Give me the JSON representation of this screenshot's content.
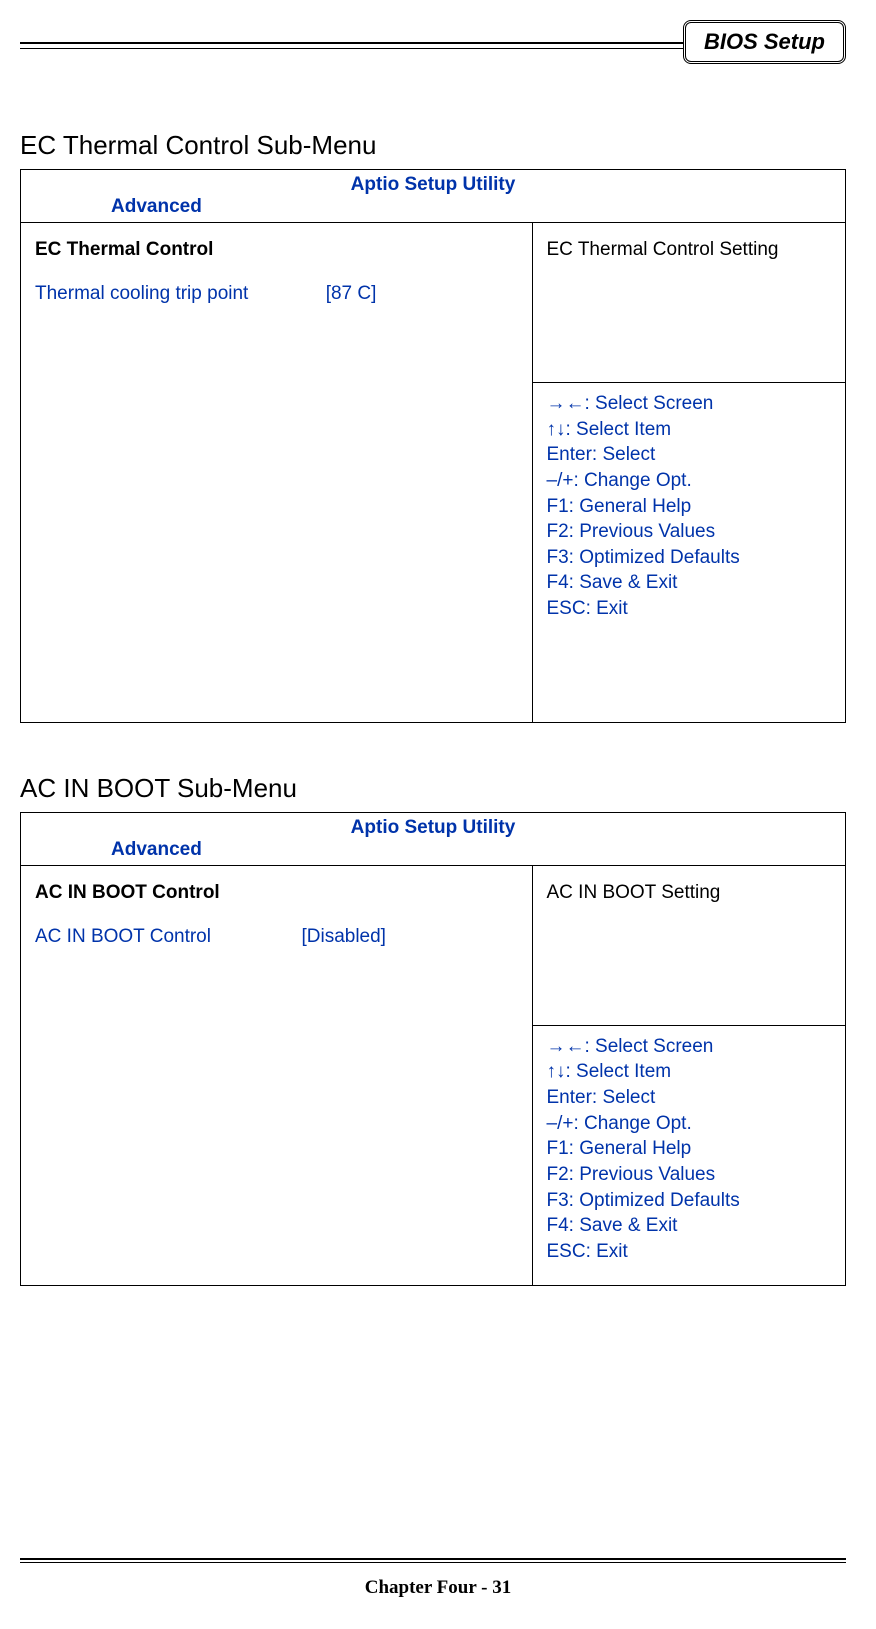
{
  "header_tag": "BIOS Setup",
  "section1": {
    "title": "EC Thermal Control Sub-Menu",
    "utility_title": "Aptio Setup Utility",
    "tab": "Advanced",
    "group_heading": "EC Thermal Control",
    "opt_label": "Thermal cooling trip point",
    "opt_value": "[87 C]",
    "description": "EC Thermal Control Setting"
  },
  "section2": {
    "title": "AC IN BOOT Sub-Menu",
    "utility_title": "Aptio Setup Utility",
    "tab": "Advanced",
    "group_heading": "AC IN BOOT Control",
    "opt_label": "AC IN BOOT Control",
    "opt_value": "[Disabled]",
    "description": "AC IN BOOT Setting"
  },
  "keys": {
    "k0": "→←: Select Screen",
    "k1": "↑↓: Select Item",
    "k2": "Enter: Select",
    "k3": "–/+: Change Opt.",
    "k4": "F1: General Help",
    "k5": "F2: Previous Values",
    "k6": "F3: Optimized Defaults",
    "k7": "F4: Save & Exit",
    "k8": "ESC: Exit"
  },
  "footer": "Chapter Four - 31"
}
